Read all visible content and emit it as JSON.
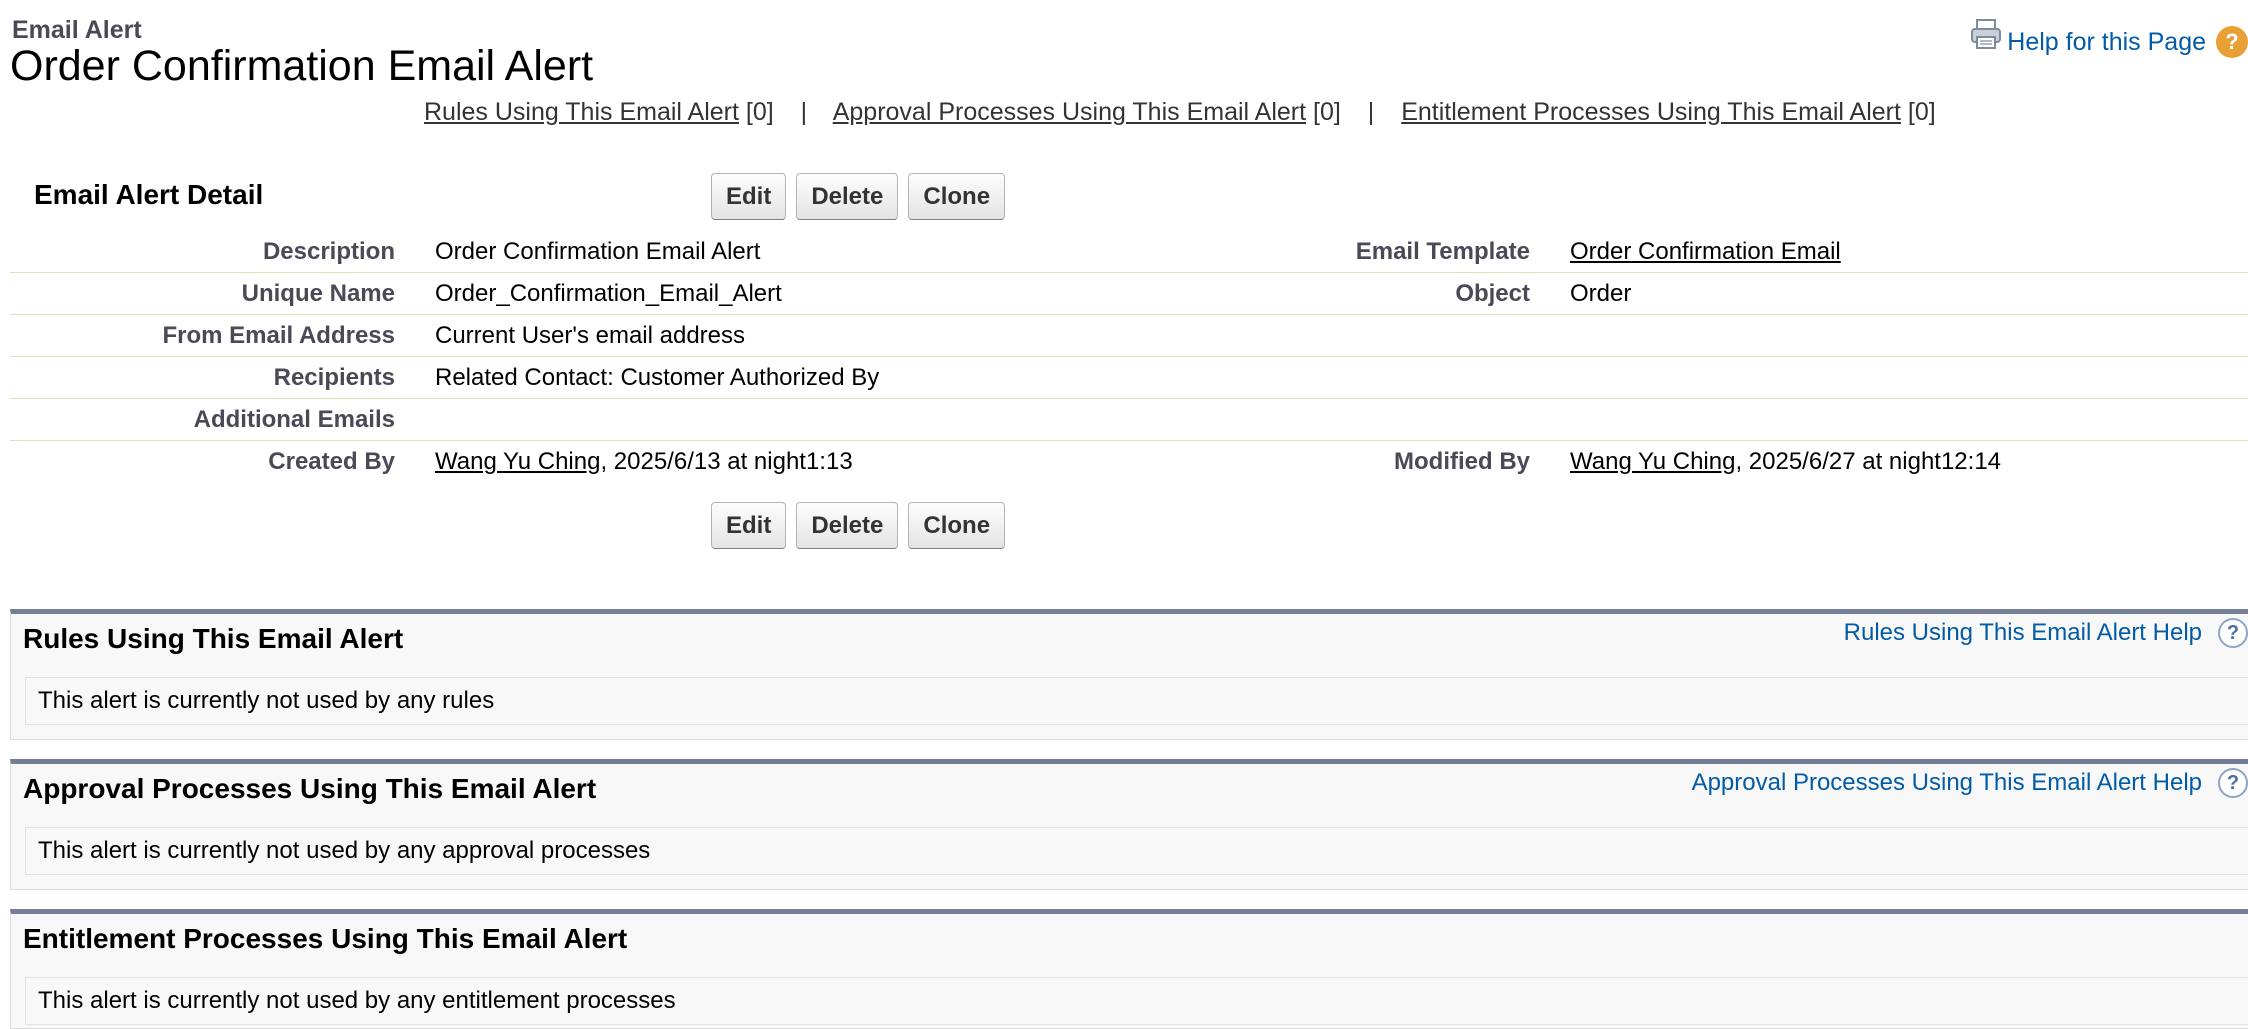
{
  "header": {
    "entity_type": "Email Alert",
    "title": "Order Confirmation Email Alert",
    "help_link": "Help for this Page",
    "help_icon": "?"
  },
  "related_links": [
    {
      "label": "Rules Using This Email Alert",
      "count": "[0]"
    },
    {
      "label": "Approval Processes Using This Email Alert",
      "count": "[0]"
    },
    {
      "label": "Entitlement Processes Using This Email Alert",
      "count": "[0]"
    }
  ],
  "related_links_separator": "|",
  "detail": {
    "title": "Email Alert Detail",
    "buttons": {
      "edit": "Edit",
      "delete": "Delete",
      "clone": "Clone"
    },
    "fields": {
      "description_label": "Description",
      "description_value": "Order Confirmation Email Alert",
      "email_template_label": "Email Template",
      "email_template_value": "Order Confirmation Email",
      "unique_name_label": "Unique Name",
      "unique_name_value": "Order_Confirmation_Email_Alert",
      "object_label": "Object",
      "object_value": "Order",
      "from_email_label": "From Email Address",
      "from_email_value": "Current User's email address",
      "recipients_label": "Recipients",
      "recipients_value": "Related Contact: Customer Authorized By",
      "additional_emails_label": "Additional Emails",
      "additional_emails_value": "",
      "created_by_label": "Created By",
      "created_by_user": "Wang Yu Ching",
      "created_by_date": ", 2025/6/13 at night1:13",
      "modified_by_label": "Modified By",
      "modified_by_user": "Wang Yu Ching",
      "modified_by_date": ", 2025/6/27 at night12:14"
    }
  },
  "related_lists": [
    {
      "title": "Rules Using This Email Alert",
      "help": "Rules Using This Email Alert Help",
      "empty_message": "This alert is currently not used by any rules"
    },
    {
      "title": "Approval Processes Using This Email Alert",
      "help": "Approval Processes Using This Email Alert Help",
      "empty_message": "This alert is currently not used by any approval processes"
    },
    {
      "title": "Entitlement Processes Using This Email Alert",
      "help": "",
      "empty_message": "This alert is currently not used by any entitlement processes"
    }
  ],
  "colors": {
    "link_blue": "#015ba7",
    "section_border": "#747e96",
    "help_orange": "#e8a036",
    "label_gray": "#4a4a56"
  },
  "icons": {
    "printer": "printer-icon",
    "help": "help-icon",
    "related_help": "question-icon"
  }
}
